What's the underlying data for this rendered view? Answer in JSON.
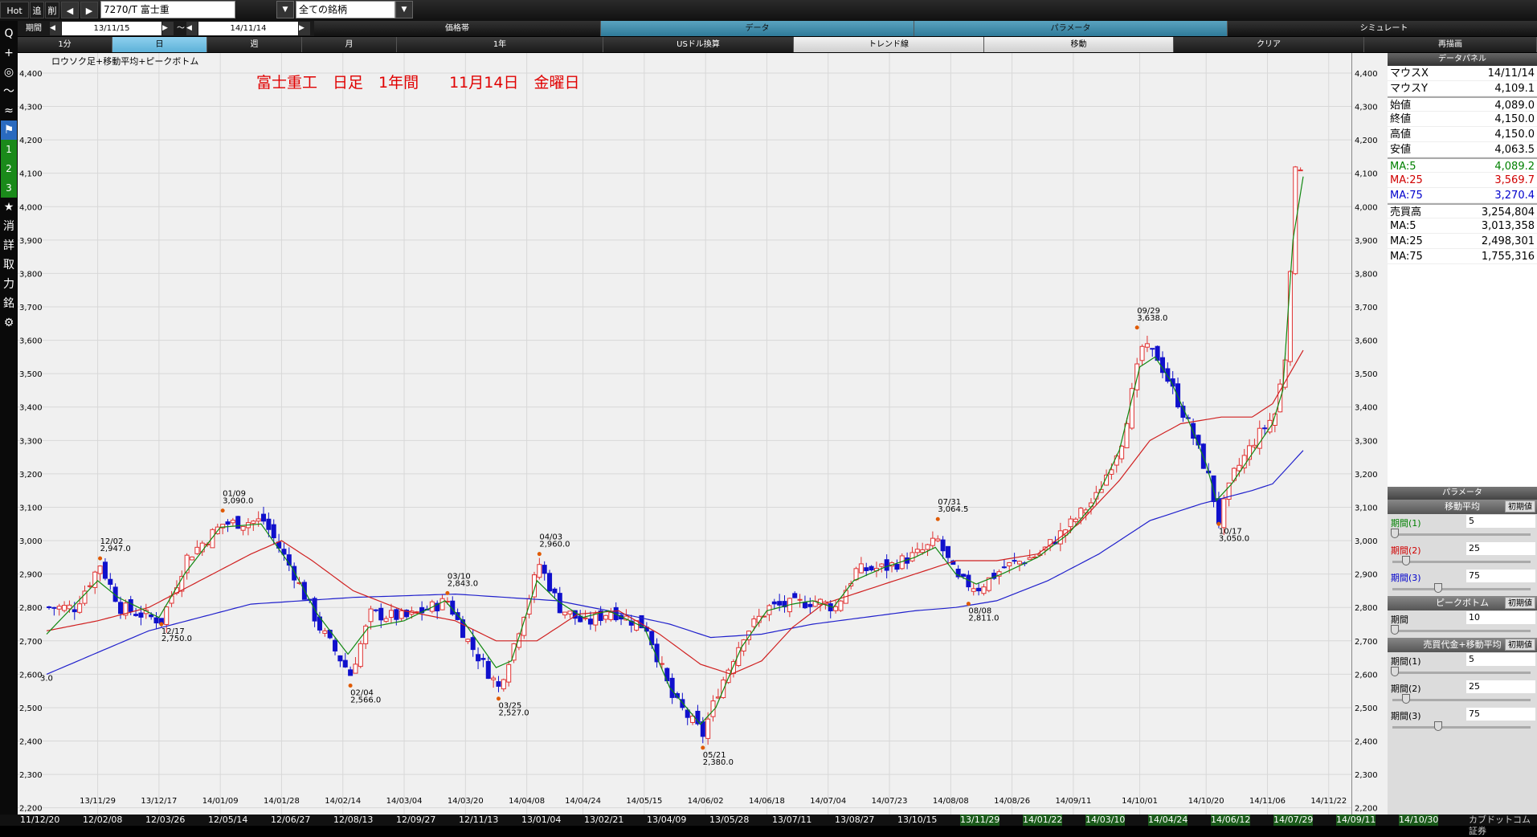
{
  "topbar": {
    "hot": "Hot",
    "add": "追",
    "del": "削",
    "prev": "◀",
    "next": "▶",
    "symbol": "7270/T 富士重",
    "universe": "全ての銘柄",
    "period_label": "期間",
    "from": "13/11/15",
    "to": "14/11/14",
    "tilde": "～"
  },
  "tabs_row2": [
    {
      "label": "価格帯",
      "on": false
    },
    {
      "label": "データ",
      "on": true
    },
    {
      "label": "パラメータ",
      "on": true
    },
    {
      "label": "シミュレート",
      "on": false
    }
  ],
  "tabs_row3": [
    {
      "label": "1分",
      "style": "dark"
    },
    {
      "label": "日",
      "style": "on"
    },
    {
      "label": "週",
      "style": "dark"
    },
    {
      "label": "月",
      "style": "dark"
    },
    {
      "label": "1年",
      "style": "dark"
    },
    {
      "label": "USドル換算",
      "style": "dark"
    },
    {
      "label": "トレンド線",
      "style": "light"
    },
    {
      "label": "移動",
      "style": "light"
    },
    {
      "label": "クリア",
      "style": "dark"
    },
    {
      "label": "再描画",
      "style": "dark"
    }
  ],
  "leftbar": [
    "Q",
    "+",
    "◎",
    "～",
    "≈",
    "⚑",
    "1",
    "2",
    "3",
    "★",
    "消",
    "詳",
    "取",
    "力",
    "銘",
    "⚙"
  ],
  "chart_title_small": "ロウソク足+移動平均+ピークボトム",
  "chart_caption": "富士重工　日足　1年間　　11月14日　金曜日",
  "datapanel": {
    "header": "データパネル",
    "rows": [
      {
        "k": "マウスX",
        "v": "14/11/14",
        "c": "#000"
      },
      {
        "k": "マウスY",
        "v": "4,109.1",
        "c": "#000"
      },
      {
        "k": "始値",
        "v": "4,089.0",
        "c": "#000"
      },
      {
        "k": "終値",
        "v": "4,150.0",
        "c": "#000"
      },
      {
        "k": "高値",
        "v": "4,150.0",
        "c": "#000"
      },
      {
        "k": "安値",
        "v": "4,063.5",
        "c": "#000"
      },
      {
        "k": "MA:5",
        "v": "4,089.2",
        "c": "#008000"
      },
      {
        "k": "MA:25",
        "v": "3,569.7",
        "c": "#d00000"
      },
      {
        "k": "MA:75",
        "v": "3,270.4",
        "c": "#0000cc"
      },
      {
        "k": "売買高",
        "v": "3,254,804",
        "c": "#000"
      },
      {
        "k": "MA:5",
        "v": "3,013,358",
        "c": "#000"
      },
      {
        "k": "MA:25",
        "v": "2,498,301",
        "c": "#000"
      },
      {
        "k": "MA:75",
        "v": "1,755,316",
        "c": "#000"
      }
    ]
  },
  "params": {
    "header": "パラメータ",
    "reset": "初期値",
    "ma_title": "移動平均",
    "ma": [
      {
        "label": "期間(1)",
        "value": "5",
        "color": "#008000",
        "knob": 0.02
      },
      {
        "label": "期間(2)",
        "value": "25",
        "color": "#d00000",
        "knob": 0.1
      },
      {
        "label": "期間(3)",
        "value": "75",
        "color": "#0000cc",
        "knob": 0.33
      }
    ],
    "pb_title": "ピークボトム",
    "pb": {
      "label": "期間",
      "value": "10",
      "knob": 0.02
    },
    "vol_title": "売買代金+移動平均",
    "vol": [
      {
        "label": "期間(1)",
        "value": "5",
        "knob": 0.02
      },
      {
        "label": "期間(2)",
        "value": "25",
        "knob": 0.1
      },
      {
        "label": "期間(3)",
        "value": "75",
        "knob": 0.33
      }
    ]
  },
  "bottom_dates": [
    "11/12/20",
    "12/02/08",
    "12/03/26",
    "12/05/14",
    "12/06/27",
    "12/08/13",
    "12/09/27",
    "12/11/13",
    "13/01/04",
    "13/02/21",
    "13/04/09",
    "13/05/28",
    "13/07/11",
    "13/08/27",
    "13/10/15",
    "13/11/29",
    "14/01/22",
    "14/03/10",
    "14/04/24",
    "14/06/12",
    "14/07/29",
    "14/09/11",
    "14/10/30"
  ],
  "bottom_logo": "カブドットコム証券",
  "chart_data": {
    "type": "candlestick",
    "y_ticks": [
      2200,
      2300,
      2400,
      2500,
      2600,
      2700,
      2800,
      2900,
      3000,
      3100,
      3200,
      3300,
      3400,
      3500,
      3600,
      3700,
      3800,
      3900,
      4000,
      4100,
      4200,
      4300,
      4400
    ],
    "y_tick_labels": [
      "2,200",
      "2,300",
      "2,400",
      "2,500",
      "2,600",
      "2,700",
      "2,800",
      "2,900",
      "3,000",
      "3,100",
      "3,200",
      "3,300",
      "3,400",
      "3,500",
      "3,600",
      "3,700",
      "3,800",
      "3,900",
      "4,000",
      "4,100",
      "4,200",
      "4,300",
      "4,400"
    ],
    "ylim": [
      2180,
      4460
    ],
    "x_ticks": [
      "13/11/29",
      "13/12/17",
      "14/01/09",
      "14/01/28",
      "14/02/14",
      "14/03/04",
      "14/03/20",
      "14/04/08",
      "14/04/24",
      "14/05/15",
      "14/06/02",
      "14/06/18",
      "14/07/04",
      "14/07/23",
      "14/08/08",
      "14/08/26",
      "14/09/11",
      "14/10/01",
      "14/10/20",
      "14/11/06",
      "14/11/22"
    ],
    "x_tick_index": [
      10,
      22,
      34,
      46,
      58,
      70,
      82,
      94,
      105,
      117,
      129,
      141,
      153,
      165,
      177,
      189,
      201,
      214,
      227,
      239,
      251
    ],
    "n_days": 246,
    "close_anchors": [
      [
        0,
        2800
      ],
      [
        5,
        2800
      ],
      [
        10,
        2930
      ],
      [
        14,
        2800
      ],
      [
        22,
        2760
      ],
      [
        27,
        2950
      ],
      [
        34,
        3050
      ],
      [
        42,
        3060
      ],
      [
        48,
        2900
      ],
      [
        53,
        2740
      ],
      [
        59,
        2600
      ],
      [
        63,
        2780
      ],
      [
        70,
        2770
      ],
      [
        78,
        2820
      ],
      [
        82,
        2700
      ],
      [
        88,
        2560
      ],
      [
        91,
        2690
      ],
      [
        96,
        2930
      ],
      [
        100,
        2800
      ],
      [
        105,
        2750
      ],
      [
        110,
        2790
      ],
      [
        117,
        2740
      ],
      [
        122,
        2530
      ],
      [
        128,
        2420
      ],
      [
        131,
        2550
      ],
      [
        136,
        2720
      ],
      [
        141,
        2800
      ],
      [
        146,
        2810
      ],
      [
        150,
        2820
      ],
      [
        154,
        2800
      ],
      [
        158,
        2910
      ],
      [
        164,
        2920
      ],
      [
        170,
        2960
      ],
      [
        174,
        3000
      ],
      [
        178,
        2880
      ],
      [
        182,
        2860
      ],
      [
        187,
        2920
      ],
      [
        194,
        2960
      ],
      [
        200,
        3050
      ],
      [
        205,
        3130
      ],
      [
        210,
        3300
      ],
      [
        214,
        3580
      ],
      [
        217,
        3550
      ],
      [
        220,
        3450
      ],
      [
        223,
        3350
      ],
      [
        227,
        3190
      ],
      [
        229,
        3060
      ],
      [
        232,
        3200
      ],
      [
        236,
        3300
      ],
      [
        240,
        3380
      ],
      [
        242,
        3550
      ],
      [
        244,
        4100
      ],
      [
        246,
        4150
      ]
    ],
    "ma5_anchors": [
      [
        0,
        2720
      ],
      [
        10,
        2880
      ],
      [
        14,
        2830
      ],
      [
        22,
        2770
      ],
      [
        27,
        2900
      ],
      [
        34,
        3040
      ],
      [
        42,
        3050
      ],
      [
        48,
        2920
      ],
      [
        53,
        2780
      ],
      [
        59,
        2660
      ],
      [
        63,
        2740
      ],
      [
        70,
        2760
      ],
      [
        78,
        2820
      ],
      [
        82,
        2750
      ],
      [
        88,
        2620
      ],
      [
        91,
        2640
      ],
      [
        96,
        2880
      ],
      [
        100,
        2820
      ],
      [
        105,
        2770
      ],
      [
        110,
        2790
      ],
      [
        117,
        2740
      ],
      [
        122,
        2560
      ],
      [
        128,
        2450
      ],
      [
        131,
        2500
      ],
      [
        136,
        2680
      ],
      [
        141,
        2790
      ],
      [
        146,
        2810
      ],
      [
        150,
        2820
      ],
      [
        154,
        2800
      ],
      [
        158,
        2880
      ],
      [
        164,
        2920
      ],
      [
        170,
        2950
      ],
      [
        174,
        2980
      ],
      [
        178,
        2900
      ],
      [
        182,
        2870
      ],
      [
        187,
        2900
      ],
      [
        194,
        2950
      ],
      [
        200,
        3020
      ],
      [
        205,
        3110
      ],
      [
        210,
        3270
      ],
      [
        214,
        3520
      ],
      [
        217,
        3550
      ],
      [
        220,
        3480
      ],
      [
        223,
        3380
      ],
      [
        227,
        3230
      ],
      [
        229,
        3120
      ],
      [
        232,
        3170
      ],
      [
        236,
        3260
      ],
      [
        240,
        3350
      ],
      [
        242,
        3450
      ],
      [
        244,
        3900
      ],
      [
        246,
        4090
      ]
    ],
    "ma25_anchors": [
      [
        0,
        2730
      ],
      [
        10,
        2760
      ],
      [
        20,
        2800
      ],
      [
        30,
        2880
      ],
      [
        40,
        2960
      ],
      [
        46,
        3000
      ],
      [
        52,
        2940
      ],
      [
        60,
        2850
      ],
      [
        70,
        2790
      ],
      [
        80,
        2760
      ],
      [
        88,
        2700
      ],
      [
        96,
        2700
      ],
      [
        104,
        2780
      ],
      [
        112,
        2790
      ],
      [
        120,
        2720
      ],
      [
        128,
        2630
      ],
      [
        134,
        2600
      ],
      [
        140,
        2640
      ],
      [
        146,
        2740
      ],
      [
        152,
        2810
      ],
      [
        160,
        2850
      ],
      [
        170,
        2900
      ],
      [
        178,
        2940
      ],
      [
        186,
        2940
      ],
      [
        194,
        2960
      ],
      [
        202,
        3050
      ],
      [
        210,
        3180
      ],
      [
        216,
        3300
      ],
      [
        222,
        3350
      ],
      [
        230,
        3370
      ],
      [
        236,
        3370
      ],
      [
        240,
        3410
      ],
      [
        246,
        3570
      ]
    ],
    "ma75_anchors": [
      [
        0,
        2600
      ],
      [
        20,
        2730
      ],
      [
        40,
        2810
      ],
      [
        60,
        2830
      ],
      [
        80,
        2840
      ],
      [
        100,
        2820
      ],
      [
        110,
        2790
      ],
      [
        122,
        2750
      ],
      [
        130,
        2710
      ],
      [
        140,
        2720
      ],
      [
        150,
        2750
      ],
      [
        160,
        2770
      ],
      [
        170,
        2790
      ],
      [
        178,
        2800
      ],
      [
        186,
        2820
      ],
      [
        196,
        2880
      ],
      [
        206,
        2960
      ],
      [
        216,
        3060
      ],
      [
        226,
        3110
      ],
      [
        236,
        3150
      ],
      [
        240,
        3170
      ],
      [
        246,
        3270
      ]
    ],
    "peaks": [
      {
        "i": 10,
        "date": "12/02",
        "value": "2,947.0",
        "kind": "peak"
      },
      {
        "i": 22,
        "date": "12/17",
        "value": "2,750.0",
        "kind": "bottom"
      },
      {
        "i": 34,
        "date": "01/09",
        "value": "3,090.0",
        "kind": "peak"
      },
      {
        "i": 59,
        "date": "02/04",
        "value": "2,566.0",
        "kind": "bottom"
      },
      {
        "i": 78,
        "date": "03/10",
        "value": "2,843.0",
        "kind": "peak"
      },
      {
        "i": 88,
        "date": "03/25",
        "value": "2,527.0",
        "kind": "bottom"
      },
      {
        "i": 96,
        "date": "04/03",
        "value": "2,960.0",
        "kind": "peak"
      },
      {
        "i": 128,
        "date": "05/21",
        "value": "2,380.0",
        "kind": "bottom"
      },
      {
        "i": 174,
        "date": "07/31",
        "value": "3,064.5",
        "kind": "peak"
      },
      {
        "i": 180,
        "date": "08/08",
        "value": "2,811.0",
        "kind": "bottom"
      },
      {
        "i": 213,
        "date": "09/29",
        "value": "3,638.0",
        "kind": "peak"
      },
      {
        "i": 229,
        "date": "10/17",
        "value": "3,050.0",
        "kind": "bottom"
      }
    ],
    "left_edge_label": "3.0"
  }
}
